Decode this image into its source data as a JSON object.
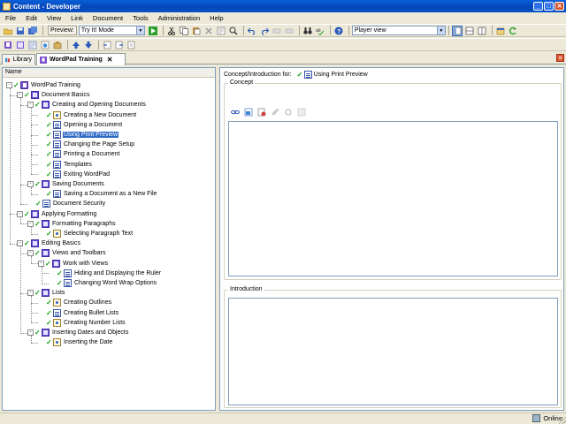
{
  "window": {
    "title": "Content - Developer",
    "controls": [
      "_",
      "□",
      "✕"
    ]
  },
  "menu": {
    "items": [
      "File",
      "Edit",
      "View",
      "Link",
      "Document",
      "Tools",
      "Administration",
      "Help"
    ]
  },
  "toolbar": {
    "preview_label": "Preview:",
    "mode_value": "Try It! Mode",
    "player_value": "Player view"
  },
  "tabs": {
    "library": "Library",
    "training": "WordPad Training",
    "close_glyph": "✕"
  },
  "tree": {
    "column_header": "Name",
    "nodes": [
      {
        "label": "WordPad Training",
        "type": "book",
        "level": 0,
        "expander": "-",
        "checked": true
      },
      {
        "label": "Document Basics",
        "type": "chapter",
        "level": 1,
        "expander": "-",
        "checked": true
      },
      {
        "label": "Creating and Opening Documents",
        "type": "chapter",
        "level": 2,
        "expander": "-",
        "checked": true
      },
      {
        "label": "Creating a New Document",
        "type": "topic",
        "level": 3,
        "expander": "",
        "checked": true
      },
      {
        "label": "Opening a Document",
        "type": "doc",
        "level": 3,
        "expander": "",
        "checked": true
      },
      {
        "label": "Using Print Preview",
        "type": "doc",
        "level": 3,
        "expander": "",
        "checked": true,
        "selected": true
      },
      {
        "label": "Changing the Page Setup",
        "type": "doc",
        "level": 3,
        "expander": "",
        "checked": true
      },
      {
        "label": "Printing a Document",
        "type": "doc",
        "level": 3,
        "expander": "",
        "checked": true
      },
      {
        "label": "Templates",
        "type": "doc",
        "level": 3,
        "expander": "",
        "checked": true
      },
      {
        "label": "Exiting WordPad",
        "type": "doc",
        "level": 3,
        "expander": "",
        "checked": true
      },
      {
        "label": "Saving Documents",
        "type": "chapter",
        "level": 2,
        "expander": "-",
        "checked": true
      },
      {
        "label": "Saving a Document as a New File",
        "type": "doc",
        "level": 3,
        "expander": "",
        "checked": true
      },
      {
        "label": "Document Security",
        "type": "doc",
        "level": 2,
        "expander": "",
        "checked": true
      },
      {
        "label": "Applying Formatting",
        "type": "chapter",
        "level": 1,
        "expander": "-",
        "checked": true
      },
      {
        "label": "Formatting Paragraphs",
        "type": "chapter",
        "level": 2,
        "expander": "-",
        "checked": true
      },
      {
        "label": "Selecting Paragraph Text",
        "type": "topic",
        "level": 3,
        "expander": "",
        "checked": true
      },
      {
        "label": "Editing Basics",
        "type": "chapter",
        "level": 1,
        "expander": "-",
        "checked": true
      },
      {
        "label": "Views and Toolbars",
        "type": "chapter",
        "level": 2,
        "expander": "-",
        "checked": true
      },
      {
        "label": "Work with Views",
        "type": "chapter",
        "level": 3,
        "expander": "-",
        "checked": true
      },
      {
        "label": "Hiding and Displaying the Ruler",
        "type": "doc",
        "level": 4,
        "expander": "",
        "checked": true
      },
      {
        "label": "Changing Word Wrap Options",
        "type": "doc",
        "level": 4,
        "expander": "",
        "checked": true
      },
      {
        "label": "Lists",
        "type": "chapter",
        "level": 2,
        "expander": "-",
        "checked": true
      },
      {
        "label": "Creating Outlines",
        "type": "topic",
        "level": 3,
        "expander": "",
        "checked": true
      },
      {
        "label": "Creating Bullet Lists",
        "type": "doc",
        "level": 3,
        "expander": "",
        "checked": true
      },
      {
        "label": "Creating Number Lists",
        "type": "topic",
        "level": 3,
        "expander": "",
        "checked": true
      },
      {
        "label": "Inserting Dates and Objects",
        "type": "chapter",
        "level": 2,
        "expander": "-",
        "checked": true
      },
      {
        "label": "Inserting the Date",
        "type": "topic",
        "level": 3,
        "expander": "",
        "checked": true
      }
    ]
  },
  "editor": {
    "concept_for_label": "Concept/Introduction for:",
    "concept_for_value": "Using Print Preview",
    "concept_group": "Concept",
    "introduction_group": "Introduction"
  },
  "status": {
    "online": "Online"
  },
  "colors": {
    "titlebar": "#0a52c8",
    "selection": "#316ac5",
    "check": "#15a015"
  }
}
